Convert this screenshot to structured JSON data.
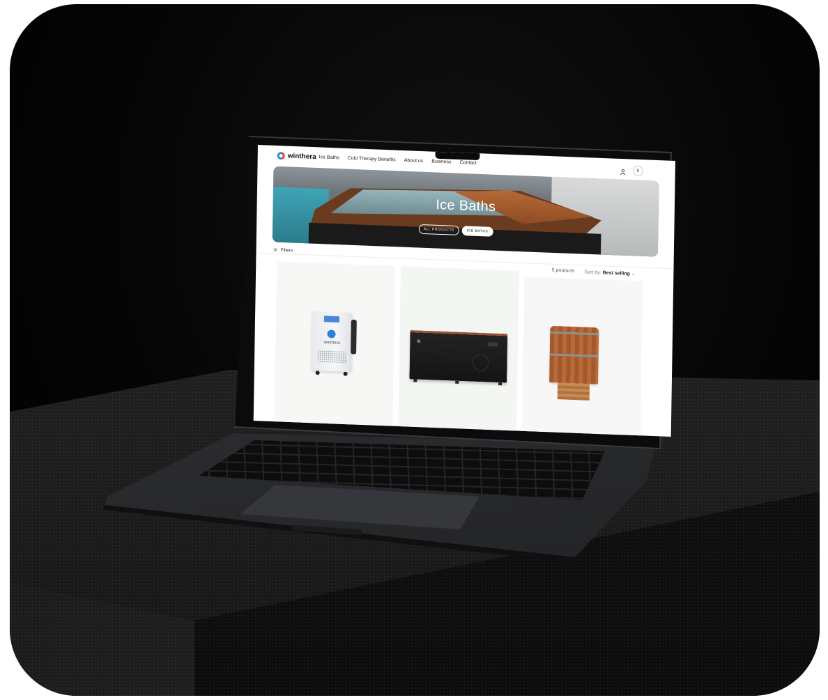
{
  "nav": {
    "brand": "winthera",
    "links": [
      "Ice Baths",
      "Cold Therapy Benefits",
      "About us",
      "Business",
      "Contact"
    ],
    "cart_count": "0"
  },
  "hero": {
    "title": "Ice Baths",
    "pills": [
      "ALL PRODUCTS",
      "ICE BATHS"
    ],
    "active_pill": "ICE BATHS"
  },
  "toolbar": {
    "filters_label": "Filters",
    "product_count": "5 products",
    "sort_prefix": "Sort by:",
    "sort_value": "Best selling"
  },
  "products": [
    {
      "type": "chiller",
      "brand_text": "winthera"
    },
    {
      "type": "black-ice-bath"
    },
    {
      "type": "wooden-barrel-ice-bath"
    }
  ],
  "colors": {
    "accent_blue": "#2f7fdb",
    "logo_red": "#e8423a",
    "wood": "#a5582b"
  },
  "icons": [
    "account-icon",
    "cart-icon",
    "filter-icon",
    "chevron-down-icon",
    "logo-icon"
  ]
}
